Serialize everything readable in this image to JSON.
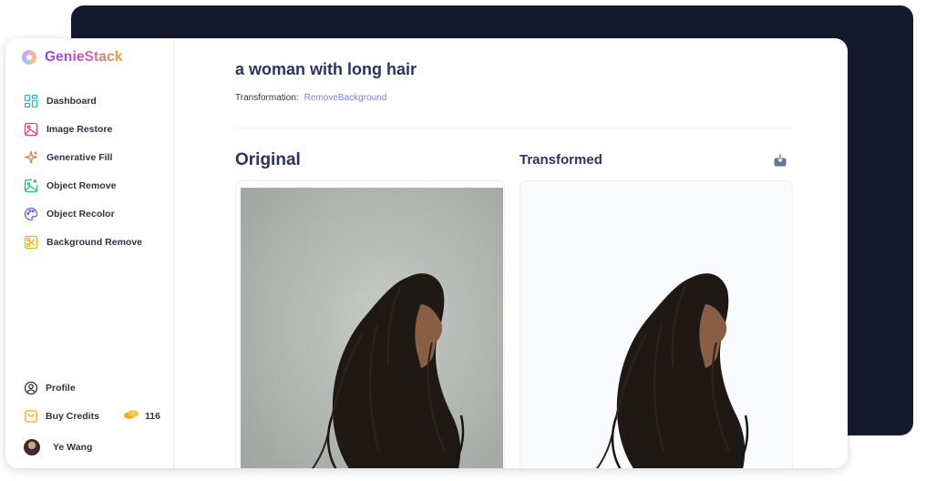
{
  "app": {
    "name": "GenieStack"
  },
  "sidebar": {
    "items": [
      {
        "label": "Dashboard",
        "icon": "dashboard-icon",
        "color": "#2ab3d6"
      },
      {
        "label": "Image Restore",
        "icon": "image-icon",
        "color": "#e04073"
      },
      {
        "label": "Generative Fill",
        "icon": "sparkle-icon",
        "color": "#ea7a3a"
      },
      {
        "label": "Object Remove",
        "icon": "image-remove-icon",
        "color": "#2bb57b"
      },
      {
        "label": "Object Recolor",
        "icon": "palette-icon",
        "color": "#6c5fe0"
      },
      {
        "label": "Background Remove",
        "icon": "scissors-icon",
        "color": "#e8b21b"
      }
    ],
    "profile_label": "Profile",
    "buy_credits_label": "Buy Credits",
    "credits": "116",
    "user_name": "Ye Wang"
  },
  "main": {
    "title": "a woman with long hair",
    "transformation_label": "Transformation:",
    "transformation_value": "RemoveBackground",
    "original_title": "Original",
    "transformed_title": "Transformed"
  },
  "colors": {
    "accent": "#7c82e3",
    "heading": "#2b3264",
    "backdrop": "#141a2b"
  }
}
